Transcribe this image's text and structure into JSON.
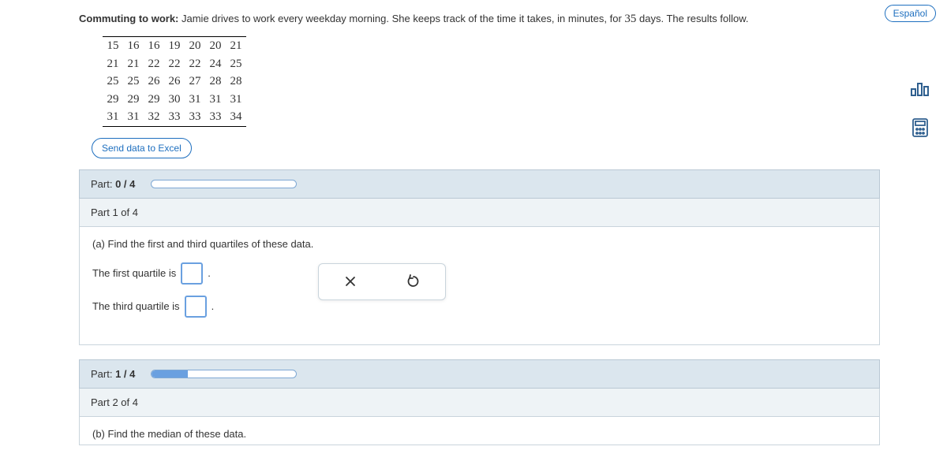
{
  "language_button": "Español",
  "problem": {
    "title": "Commuting to work:",
    "text_before_num": " Jamie drives to work every weekday morning. She keeps track of the time it takes, in minutes, for ",
    "num": "35",
    "text_after_num": " days. The results follow."
  },
  "data_rows": [
    [
      "15",
      "16",
      "16",
      "19",
      "20",
      "20",
      "21"
    ],
    [
      "21",
      "21",
      "22",
      "22",
      "22",
      "24",
      "25"
    ],
    [
      "25",
      "25",
      "26",
      "26",
      "27",
      "28",
      "28"
    ],
    [
      "29",
      "29",
      "29",
      "30",
      "31",
      "31",
      "31"
    ],
    [
      "31",
      "31",
      "32",
      "33",
      "33",
      "33",
      "34"
    ]
  ],
  "excel_button": "Send data to Excel",
  "part0": {
    "label_prefix": "Part: ",
    "label_value": "0 / 4",
    "progress_pct": 0
  },
  "part1_header": "Part 1 of 4",
  "part1_body": {
    "question": "(a) Find the first and third quartiles of these data.",
    "line1_before": "The first quartile is ",
    "line1_after": ".",
    "line2_before": "The third quartile is ",
    "line2_after": "."
  },
  "toolbox": {
    "close_symbol": "×",
    "reset_symbol": "↺"
  },
  "partA": {
    "label_prefix": "Part: ",
    "label_value": "1 / 4",
    "progress_pct": 25
  },
  "part2_header": "Part 2 of 4",
  "part2_body": {
    "question": "(b) Find the median of these data."
  },
  "icons": {
    "chart": "chart-icon",
    "calc": "calculator-icon"
  }
}
